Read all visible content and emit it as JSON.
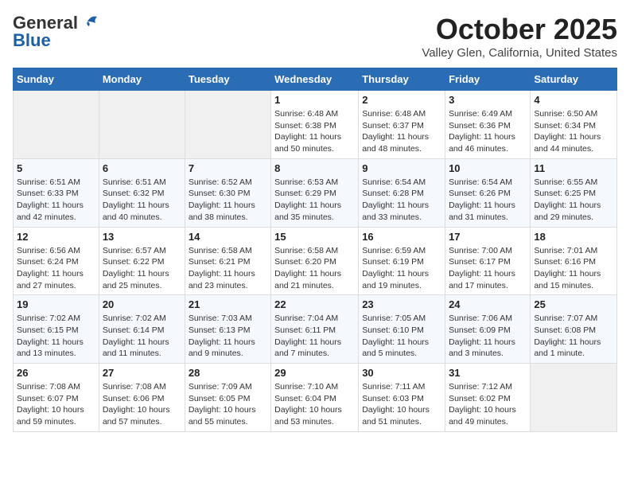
{
  "header": {
    "logo_general": "General",
    "logo_blue": "Blue",
    "month": "October 2025",
    "location": "Valley Glen, California, United States"
  },
  "days_of_week": [
    "Sunday",
    "Monday",
    "Tuesday",
    "Wednesday",
    "Thursday",
    "Friday",
    "Saturday"
  ],
  "weeks": [
    [
      {
        "day": "",
        "info": ""
      },
      {
        "day": "",
        "info": ""
      },
      {
        "day": "",
        "info": ""
      },
      {
        "day": "1",
        "info": "Sunrise: 6:48 AM\nSunset: 6:38 PM\nDaylight: 11 hours and 50 minutes."
      },
      {
        "day": "2",
        "info": "Sunrise: 6:48 AM\nSunset: 6:37 PM\nDaylight: 11 hours and 48 minutes."
      },
      {
        "day": "3",
        "info": "Sunrise: 6:49 AM\nSunset: 6:36 PM\nDaylight: 11 hours and 46 minutes."
      },
      {
        "day": "4",
        "info": "Sunrise: 6:50 AM\nSunset: 6:34 PM\nDaylight: 11 hours and 44 minutes."
      }
    ],
    [
      {
        "day": "5",
        "info": "Sunrise: 6:51 AM\nSunset: 6:33 PM\nDaylight: 11 hours and 42 minutes."
      },
      {
        "day": "6",
        "info": "Sunrise: 6:51 AM\nSunset: 6:32 PM\nDaylight: 11 hours and 40 minutes."
      },
      {
        "day": "7",
        "info": "Sunrise: 6:52 AM\nSunset: 6:30 PM\nDaylight: 11 hours and 38 minutes."
      },
      {
        "day": "8",
        "info": "Sunrise: 6:53 AM\nSunset: 6:29 PM\nDaylight: 11 hours and 35 minutes."
      },
      {
        "day": "9",
        "info": "Sunrise: 6:54 AM\nSunset: 6:28 PM\nDaylight: 11 hours and 33 minutes."
      },
      {
        "day": "10",
        "info": "Sunrise: 6:54 AM\nSunset: 6:26 PM\nDaylight: 11 hours and 31 minutes."
      },
      {
        "day": "11",
        "info": "Sunrise: 6:55 AM\nSunset: 6:25 PM\nDaylight: 11 hours and 29 minutes."
      }
    ],
    [
      {
        "day": "12",
        "info": "Sunrise: 6:56 AM\nSunset: 6:24 PM\nDaylight: 11 hours and 27 minutes."
      },
      {
        "day": "13",
        "info": "Sunrise: 6:57 AM\nSunset: 6:22 PM\nDaylight: 11 hours and 25 minutes."
      },
      {
        "day": "14",
        "info": "Sunrise: 6:58 AM\nSunset: 6:21 PM\nDaylight: 11 hours and 23 minutes."
      },
      {
        "day": "15",
        "info": "Sunrise: 6:58 AM\nSunset: 6:20 PM\nDaylight: 11 hours and 21 minutes."
      },
      {
        "day": "16",
        "info": "Sunrise: 6:59 AM\nSunset: 6:19 PM\nDaylight: 11 hours and 19 minutes."
      },
      {
        "day": "17",
        "info": "Sunrise: 7:00 AM\nSunset: 6:17 PM\nDaylight: 11 hours and 17 minutes."
      },
      {
        "day": "18",
        "info": "Sunrise: 7:01 AM\nSunset: 6:16 PM\nDaylight: 11 hours and 15 minutes."
      }
    ],
    [
      {
        "day": "19",
        "info": "Sunrise: 7:02 AM\nSunset: 6:15 PM\nDaylight: 11 hours and 13 minutes."
      },
      {
        "day": "20",
        "info": "Sunrise: 7:02 AM\nSunset: 6:14 PM\nDaylight: 11 hours and 11 minutes."
      },
      {
        "day": "21",
        "info": "Sunrise: 7:03 AM\nSunset: 6:13 PM\nDaylight: 11 hours and 9 minutes."
      },
      {
        "day": "22",
        "info": "Sunrise: 7:04 AM\nSunset: 6:11 PM\nDaylight: 11 hours and 7 minutes."
      },
      {
        "day": "23",
        "info": "Sunrise: 7:05 AM\nSunset: 6:10 PM\nDaylight: 11 hours and 5 minutes."
      },
      {
        "day": "24",
        "info": "Sunrise: 7:06 AM\nSunset: 6:09 PM\nDaylight: 11 hours and 3 minutes."
      },
      {
        "day": "25",
        "info": "Sunrise: 7:07 AM\nSunset: 6:08 PM\nDaylight: 11 hours and 1 minute."
      }
    ],
    [
      {
        "day": "26",
        "info": "Sunrise: 7:08 AM\nSunset: 6:07 PM\nDaylight: 10 hours and 59 minutes."
      },
      {
        "day": "27",
        "info": "Sunrise: 7:08 AM\nSunset: 6:06 PM\nDaylight: 10 hours and 57 minutes."
      },
      {
        "day": "28",
        "info": "Sunrise: 7:09 AM\nSunset: 6:05 PM\nDaylight: 10 hours and 55 minutes."
      },
      {
        "day": "29",
        "info": "Sunrise: 7:10 AM\nSunset: 6:04 PM\nDaylight: 10 hours and 53 minutes."
      },
      {
        "day": "30",
        "info": "Sunrise: 7:11 AM\nSunset: 6:03 PM\nDaylight: 10 hours and 51 minutes."
      },
      {
        "day": "31",
        "info": "Sunrise: 7:12 AM\nSunset: 6:02 PM\nDaylight: 10 hours and 49 minutes."
      },
      {
        "day": "",
        "info": ""
      }
    ]
  ]
}
